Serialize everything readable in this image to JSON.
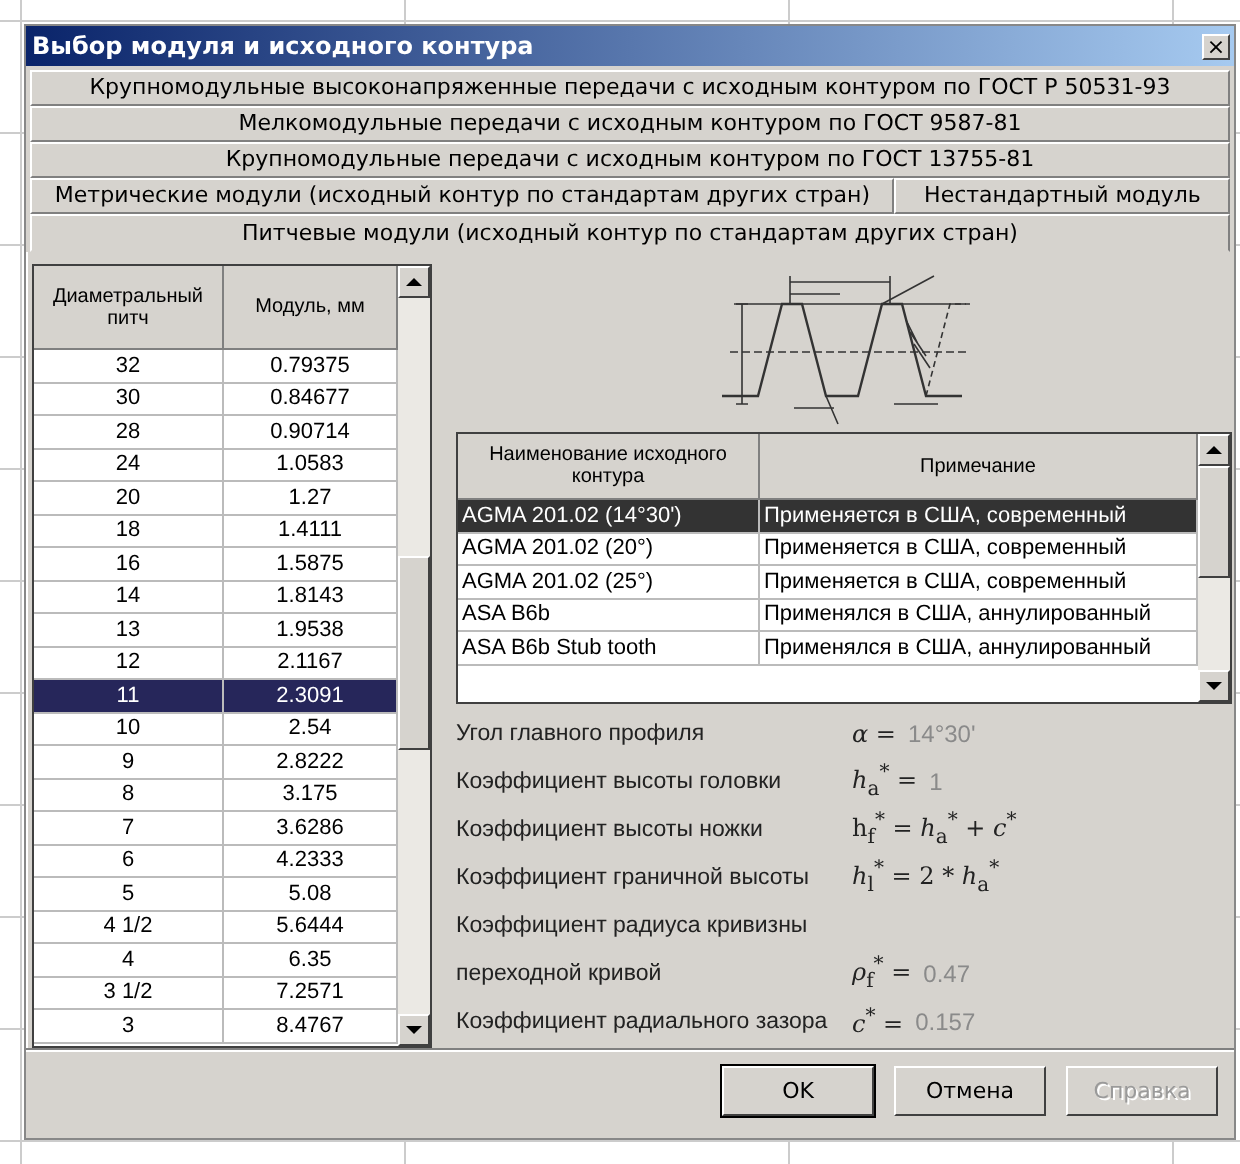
{
  "window": {
    "title": "Выбор модуля и исходного контура",
    "close": "×"
  },
  "tab_rows": [
    [
      {
        "label": "Крупномодульные высоконапряженные передачи с исходным контуром по ГОСТ Р 50531-93",
        "selected": false
      }
    ],
    [
      {
        "label": "Мелкомодульные передачи с исходным контуром по ГОСТ  9587-81",
        "selected": false
      }
    ],
    [
      {
        "label": "Крупномодульные передачи с исходным контуром по ГОСТ 13755-81",
        "selected": false
      }
    ],
    [
      {
        "label": "Метрические модули (исходный контур по стандартам других стран)",
        "selected": false
      },
      {
        "label": "Нестандартный модуль",
        "selected": false
      }
    ],
    [
      {
        "label": "Питчевые модули (исходный контур по стандартам других стран)",
        "selected": true
      }
    ]
  ],
  "pitch_table": {
    "columns": [
      "Диаметральный питч",
      "Модуль, мм"
    ],
    "rows": [
      {
        "cells": [
          "32",
          "0.79375"
        ],
        "selected": false
      },
      {
        "cells": [
          "30",
          "0.84677"
        ],
        "selected": false
      },
      {
        "cells": [
          "28",
          "0.90714"
        ],
        "selected": false
      },
      {
        "cells": [
          "24",
          "1.0583"
        ],
        "selected": false
      },
      {
        "cells": [
          "20",
          "1.27"
        ],
        "selected": false
      },
      {
        "cells": [
          "18",
          "1.4111"
        ],
        "selected": false
      },
      {
        "cells": [
          "16",
          "1.5875"
        ],
        "selected": false
      },
      {
        "cells": [
          "14",
          "1.8143"
        ],
        "selected": false
      },
      {
        "cells": [
          "13",
          "1.9538"
        ],
        "selected": false
      },
      {
        "cells": [
          "12",
          "2.1167"
        ],
        "selected": false
      },
      {
        "cells": [
          "11",
          "2.3091"
        ],
        "selected": true
      },
      {
        "cells": [
          "10",
          "2.54"
        ],
        "selected": false
      },
      {
        "cells": [
          "9",
          "2.8222"
        ],
        "selected": false
      },
      {
        "cells": [
          "8",
          "3.175"
        ],
        "selected": false
      },
      {
        "cells": [
          "7",
          "3.6286"
        ],
        "selected": false
      },
      {
        "cells": [
          "6",
          "4.2333"
        ],
        "selected": false
      },
      {
        "cells": [
          "5",
          "5.08"
        ],
        "selected": false
      },
      {
        "cells": [
          "4 1/2",
          "5.6444"
        ],
        "selected": false
      },
      {
        "cells": [
          "4",
          "6.35"
        ],
        "selected": false
      },
      {
        "cells": [
          "3 1/2",
          "7.2571"
        ],
        "selected": false
      },
      {
        "cells": [
          "3",
          "8.4767"
        ],
        "selected": false
      }
    ]
  },
  "profile_table": {
    "columns": [
      "Наименование исходного контура",
      "Примечание"
    ],
    "rows": [
      {
        "cells": [
          "AGMA 201.02 (14°30')",
          "Применяется в США, современный"
        ],
        "selected": true
      },
      {
        "cells": [
          "AGMA 201.02 (20°)",
          "Применяется в США, современный"
        ],
        "selected": false
      },
      {
        "cells": [
          "AGMA 201.02 (25°)",
          "Применяется в США, современный"
        ],
        "selected": false
      },
      {
        "cells": [
          "ASA B6b",
          "Применялся в США, аннулированный"
        ],
        "selected": false
      },
      {
        "cells": [
          "ASA B6b Stub tooth",
          "Применялся в США, аннулированный"
        ],
        "selected": false
      }
    ]
  },
  "parameters": [
    {
      "label": "Угол главного профиля",
      "formula": "*α* =",
      "value": "14°30'"
    },
    {
      "label": "Коэффициент высоты головки",
      "formula": "*h*$_{a}$$^{*}$ =",
      "value": "1"
    },
    {
      "label": "Коэффициент высоты ножки",
      "formula": "h$_{f}$$^{*}$ = *h*$_{a}$$^{*}$ + *c*$^{*}$"
    },
    {
      "label": "Коэффициент граничной высоты",
      "formula": "*h*$_{l}$$^{*}$ = 2 * *h*$_{a}$$^{*}$"
    },
    {
      "label": "Коэффициент радиуса кривизны"
    },
    {
      "label": "переходной кривой",
      "formula": "*ρ*$_{f}$$^{*}$ =",
      "value": "0.47"
    },
    {
      "label": "Коэффициент радиального зазора",
      "formula": "*c*$^{*}$ =",
      "value": "0.157"
    }
  ],
  "buttons": [
    {
      "label": "OK",
      "default": true,
      "disabled": false
    },
    {
      "label": "Отмена",
      "default": false,
      "disabled": false
    },
    {
      "label": "Справка",
      "default": false,
      "disabled": true
    }
  ]
}
